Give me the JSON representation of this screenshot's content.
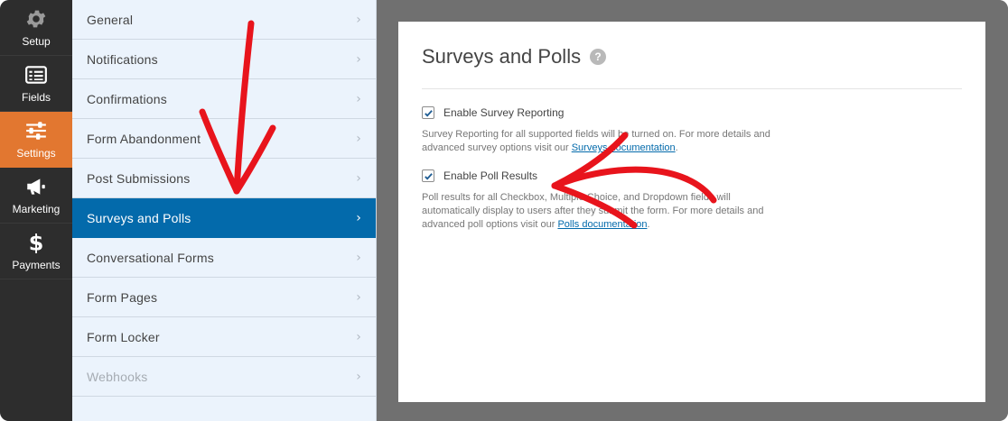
{
  "rail": {
    "items": [
      {
        "label": "Setup",
        "icon": "gear-icon"
      },
      {
        "label": "Fields",
        "icon": "fields-icon"
      },
      {
        "label": "Settings",
        "icon": "sliders-icon",
        "active": true
      },
      {
        "label": "Marketing",
        "icon": "megaphone-icon"
      },
      {
        "label": "Payments",
        "icon": "dollar-icon"
      }
    ]
  },
  "panel": {
    "items": [
      {
        "label": "General"
      },
      {
        "label": "Notifications"
      },
      {
        "label": "Confirmations"
      },
      {
        "label": "Form Abandonment"
      },
      {
        "label": "Post Submissions"
      },
      {
        "label": "Surveys and Polls",
        "active": true
      },
      {
        "label": "Conversational Forms"
      },
      {
        "label": "Form Pages"
      },
      {
        "label": "Form Locker"
      },
      {
        "label": "Webhooks",
        "disabled": true
      }
    ],
    "chevron": "›"
  },
  "content": {
    "title": "Surveys and Polls",
    "help": "?",
    "survey": {
      "label": "Enable Survey Reporting",
      "checked": true,
      "desc_before": "Survey Reporting for all supported fields will be turned on. For more details and advanced survey options visit our ",
      "link": "Surveys documentation",
      "desc_after": "."
    },
    "poll": {
      "label": "Enable Poll Results",
      "checked": true,
      "desc_before": "Poll results for all Checkbox, Multiple Choice, and Dropdown fields will automatically display to users after they submit the form. For more details and advanced poll options visit our ",
      "link": "Polls documentation",
      "desc_after": "."
    }
  },
  "colors": {
    "rail_bg": "#2d2d2d",
    "rail_active": "#e27730",
    "panel_bg": "#ebf3fc",
    "panel_active": "#036aab",
    "annotation": "#e8141c"
  }
}
